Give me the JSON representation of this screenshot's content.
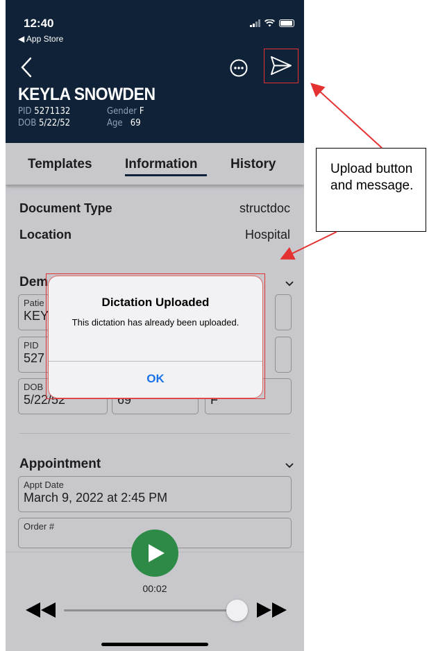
{
  "status_bar": {
    "time": "12:40",
    "back_label": "◀ App Store"
  },
  "patient": {
    "name": "KEYLA SNOWDEN",
    "pid_label": "PID",
    "pid": "5271132",
    "gender_label": "Gender",
    "gender": "F",
    "dob_label": "DOB",
    "dob": "5/22/52",
    "age_label": "Age",
    "age": "69"
  },
  "tabs": [
    {
      "label": "Templates"
    },
    {
      "label": "Information",
      "selected": true
    },
    {
      "label": "History"
    }
  ],
  "info_rows": [
    {
      "key": "Document Type",
      "value": "structdoc"
    },
    {
      "key": "Location",
      "value": "Hospital"
    }
  ],
  "demographics": {
    "title": "Dem",
    "fields": [
      {
        "label": "Patie",
        "value": "KEY"
      },
      {
        "label": "PID",
        "value": "527"
      },
      {
        "label": "DOB",
        "value": "5/22/52"
      },
      {
        "label": "",
        "value": "69"
      },
      {
        "label": "",
        "value": "F"
      }
    ]
  },
  "appointment": {
    "title": "Appointment",
    "fields": [
      {
        "label": "Appt Date",
        "value": "March 9, 2022 at 2:45 PM"
      },
      {
        "label": "Order #",
        "value": ""
      }
    ]
  },
  "player": {
    "time": "00:02",
    "progress": 0.9
  },
  "alert": {
    "title": "Dictation Uploaded",
    "message": "This dictation has already been uploaded.",
    "ok_label": "OK"
  },
  "annotation": {
    "text": "Upload button and message."
  },
  "colors": {
    "header_bg": "#0f2237",
    "accent": "#1a73e8",
    "play": "#2e8b47",
    "highlight": "#e43232"
  },
  "icons": [
    "back-chevron-icon",
    "more-options-icon",
    "send-upload-icon",
    "chevron-down-icon",
    "play-icon",
    "rewind-icon",
    "fast-forward-icon"
  ]
}
